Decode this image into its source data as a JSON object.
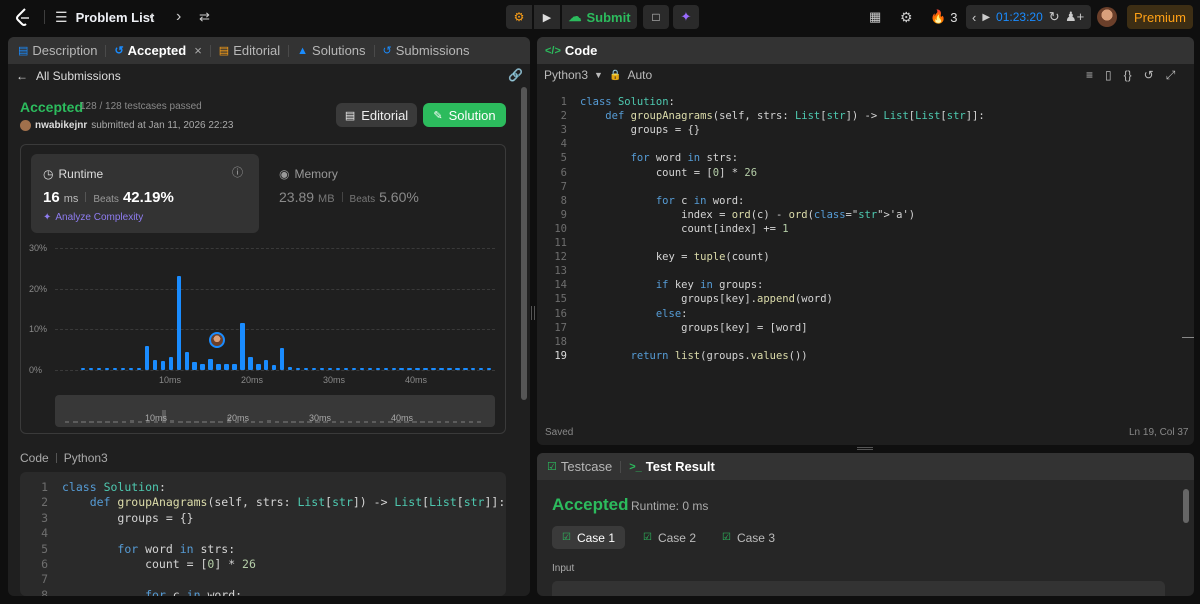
{
  "topbar": {
    "problem_list": "Problem List",
    "submit": "Submit",
    "streak_count": "3",
    "timer": "01:23:20",
    "premium": "Premium"
  },
  "left": {
    "tabs": [
      "Description",
      "Accepted",
      "Editorial",
      "Solutions",
      "Submissions"
    ],
    "all_submissions": "All Submissions",
    "status": "Accepted",
    "testcases": "128 / 128 testcases passed",
    "username": "nwabikejnr",
    "submitted_at": "submitted at Jan 11, 2026 22:23",
    "editorial_btn": "Editorial",
    "solution_btn": "Solution",
    "runtime_label": "Runtime",
    "runtime_value": "16",
    "runtime_unit": "ms",
    "runtime_beats_label": "Beats",
    "runtime_beats": "42.19%",
    "analyze": "Analyze Complexity",
    "memory_label": "Memory",
    "memory_value": "23.89",
    "memory_unit": "MB",
    "memory_beats_label": "Beats",
    "memory_beats": "5.60%",
    "code_label": "Code",
    "code_lang": "Python3"
  },
  "chart_data": {
    "type": "bar",
    "yticks": [
      "30%",
      "20%",
      "10%",
      "0%"
    ],
    "ylim": [
      0,
      30
    ],
    "xticks": [
      "10ms",
      "20ms",
      "30ms",
      "40ms"
    ],
    "values": [
      0.5,
      0.5,
      0.5,
      0.5,
      0.5,
      0.5,
      0.5,
      0.5,
      5.8,
      2.5,
      2.2,
      3.2,
      23.2,
      4.5,
      2.0,
      1.5,
      2.8,
      1.5,
      1.5,
      1.5,
      11.5,
      3.2,
      1.5,
      2.5,
      1.2,
      5.5,
      0.8,
      0.5,
      0.5,
      0.5,
      0.5,
      0.5,
      0.5,
      0.5,
      0.5,
      0.5,
      0.5,
      0.5,
      0.5,
      0.5,
      0.5,
      0.5,
      0.5,
      0.5,
      0.5,
      0.5,
      0.5,
      0.5,
      0.5,
      0.5,
      0.5,
      0.5
    ],
    "highlight_index": 17
  },
  "right": {
    "code_title": "Code",
    "language": "Python3",
    "auto": "Auto",
    "saved": "Saved",
    "cursor": "Ln 19, Col 37"
  },
  "bottom": {
    "testcase_tab": "Testcase",
    "result_tab": "Test Result",
    "status": "Accepted",
    "runtime": "Runtime: 0 ms",
    "cases": [
      "Case 1",
      "Case 2",
      "Case 3"
    ],
    "input_label": "Input"
  },
  "code_lines": [
    {
      "n": "1",
      "t": "class Solution:"
    },
    {
      "n": "2",
      "t": "    def groupAnagrams(self, strs: List[str]) -> List[List[str]]:"
    },
    {
      "n": "3",
      "t": "        groups = {}"
    },
    {
      "n": "4",
      "t": ""
    },
    {
      "n": "5",
      "t": "        for word in strs:"
    },
    {
      "n": "6",
      "t": "            count = [0] * 26"
    },
    {
      "n": "7",
      "t": ""
    },
    {
      "n": "8",
      "t": "            for c in word:"
    },
    {
      "n": "9",
      "t": "                index = ord(c) - ord('a')"
    },
    {
      "n": "10",
      "t": "                count[index] += 1"
    },
    {
      "n": "11",
      "t": ""
    },
    {
      "n": "12",
      "t": "            key = tuple(count)"
    },
    {
      "n": "13",
      "t": ""
    },
    {
      "n": "14",
      "t": "            if key in groups:"
    },
    {
      "n": "15",
      "t": "                groups[key].append(word)"
    },
    {
      "n": "16",
      "t": "            else:"
    },
    {
      "n": "17",
      "t": "                groups[key] = [word]"
    },
    {
      "n": "18",
      "t": ""
    },
    {
      "n": "19",
      "t": "        return list(groups.values())"
    }
  ],
  "colors": {
    "accent_green": "#2cbb5d",
    "orange": "#ffa116",
    "blue": "#1a8cff"
  }
}
